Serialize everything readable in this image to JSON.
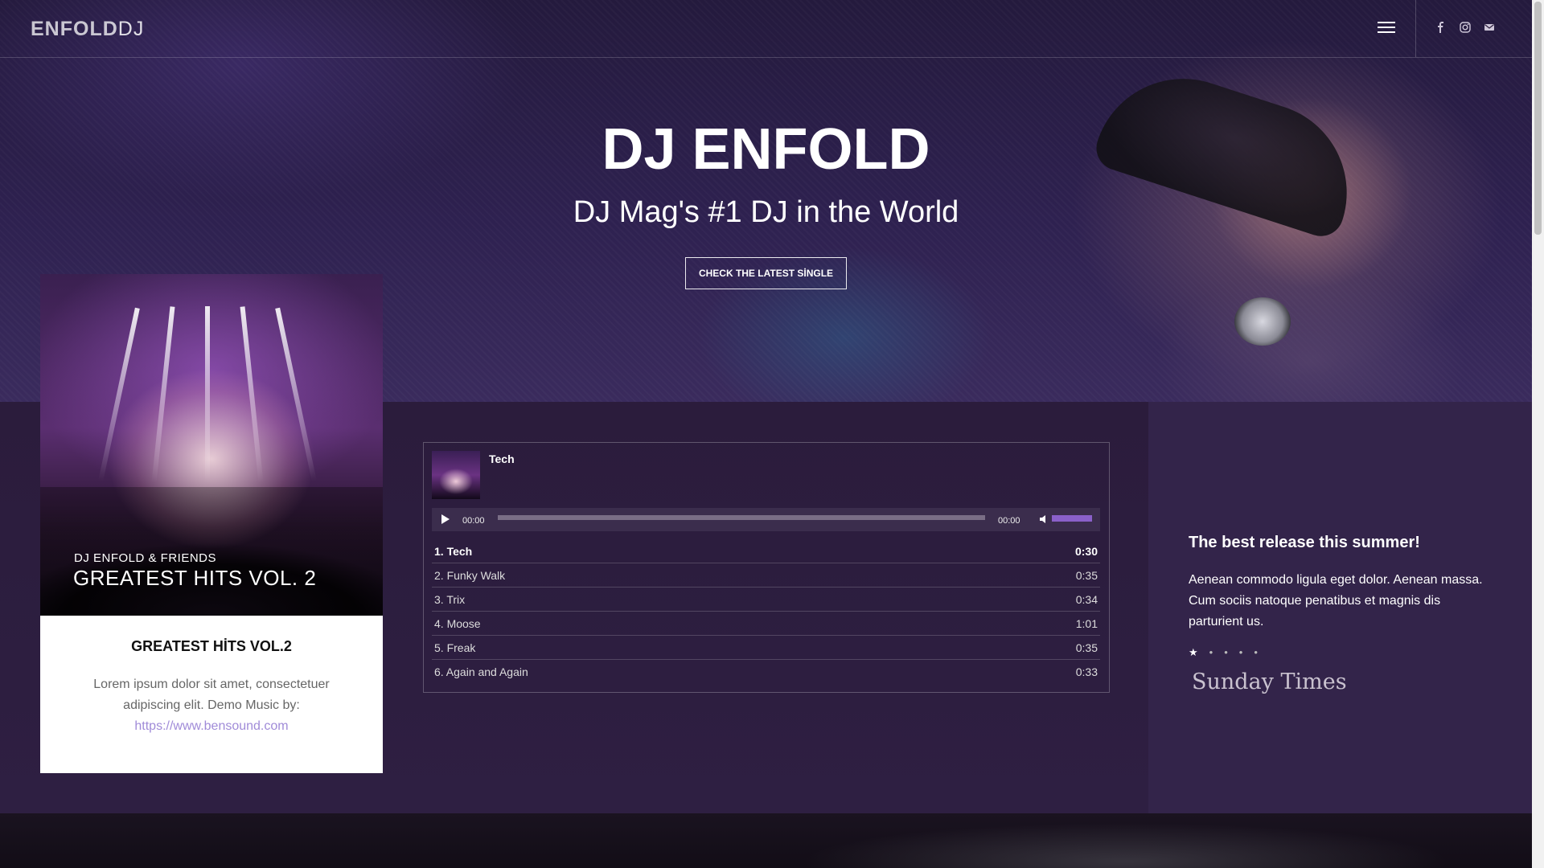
{
  "header": {
    "logo_bold": "ENFOLD",
    "logo_light": "DJ",
    "menu_icon": "hamburger-icon",
    "social": [
      "facebook-icon",
      "instagram-icon",
      "mail-icon"
    ]
  },
  "hero": {
    "title": "DJ ENFOLD",
    "subtitle": "DJ Mag's #1 DJ in the World",
    "cta": "CHECK THE LATEST SİNGLE"
  },
  "album_card": {
    "cover_line1": "DJ ENFOLD & FRIENDS",
    "cover_line2": "GREATEST HITS VOL. 2",
    "title": "GREATEST HİTS VOL.2",
    "description": "Lorem ipsum dolor sit amet, consectetuer adipiscing elit. Demo Music by:",
    "link_text": "https://www.bensound.com"
  },
  "player": {
    "now_playing": "Tech",
    "current_time": "00:00",
    "duration": "00:00",
    "volume_fraction": 1.0,
    "tracks": [
      {
        "name": "1. Tech",
        "duration": "0:30",
        "active": true
      },
      {
        "name": "2. Funky Walk",
        "duration": "0:35",
        "active": false
      },
      {
        "name": "3. Trix",
        "duration": "0:34",
        "active": false
      },
      {
        "name": "4. Moose",
        "duration": "1:01",
        "active": false
      },
      {
        "name": "5. Freak",
        "duration": "0:35",
        "active": false
      },
      {
        "name": "6. Again and Again",
        "duration": "0:33",
        "active": false
      }
    ]
  },
  "review": {
    "heading": "The best release this summer!",
    "text": "Aenean commodo ligula eget dolor. Aenean massa. Cum sociis natoque penatibus et magnis dis parturient us.",
    "rating": 1,
    "rating_max": 5,
    "source": "Sunday Times"
  },
  "colors": {
    "accent": "#a08bd8",
    "volume": "#8a60c9",
    "background": "#2a1c3b"
  }
}
